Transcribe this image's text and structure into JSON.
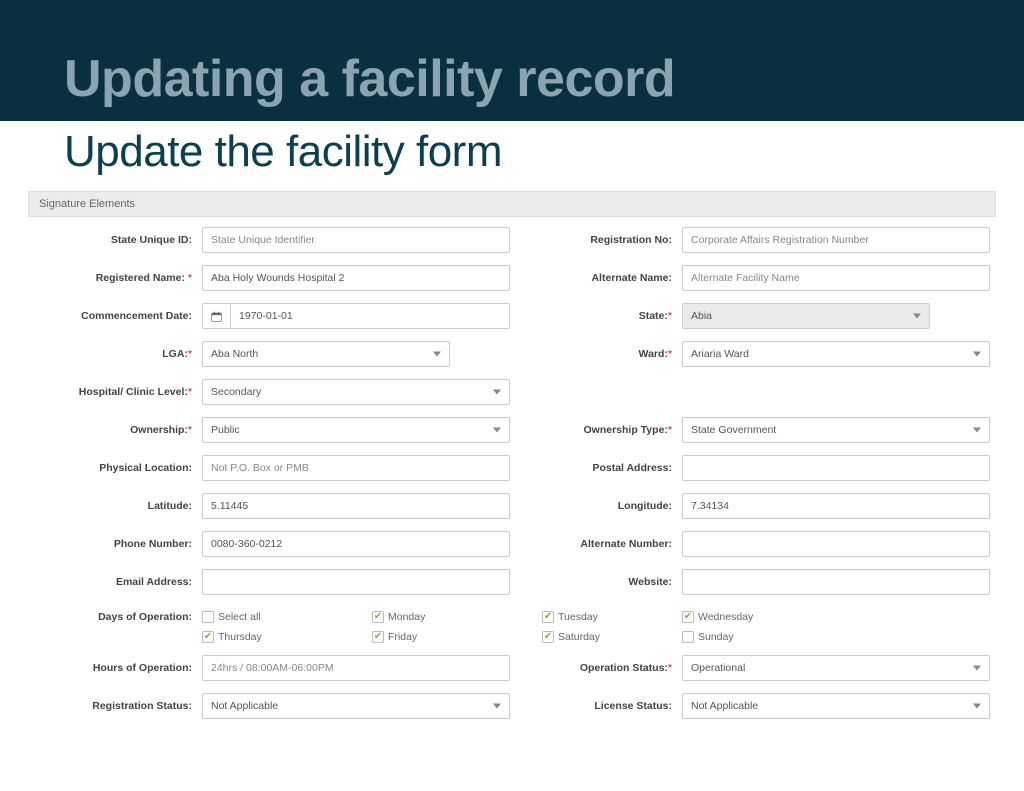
{
  "banner": {
    "title": "Updating a facility record"
  },
  "subtitle": "Update the facility form",
  "panel_heading": "Signature Elements",
  "labels": {
    "state_unique_id": "State Unique ID:",
    "registration_no": "Registration No:",
    "registered_name": "Registered Name:",
    "alternate_name": "Alternate Name:",
    "commencement_date": "Commencement Date:",
    "state": "State:",
    "lga": "LGA:",
    "ward": "Ward:",
    "hospital_level": "Hospital/ Clinic Level:",
    "ownership": "Ownership:",
    "ownership_type": "Ownership Type:",
    "physical_location": "Physical Location:",
    "postal_address": "Postal Address:",
    "latitude": "Latitude:",
    "longitude": "Longitude:",
    "phone_number": "Phone Number:",
    "alternate_number": "Alternate Number:",
    "email_address": "Email Address:",
    "website": "Website:",
    "days_of_operation": "Days of Operation:",
    "hours_of_operation": "Hours of Operation:",
    "operation_status": "Operation Status:",
    "registration_status": "Registration Status:",
    "license_status": "License Status:"
  },
  "placeholders": {
    "state_unique_id": "State Unique Identifier",
    "registration_no": "Corporate Affairs Registration Number",
    "alternate_name": "Alternate Facility Name",
    "physical_location": "Not P.O. Box or PMB",
    "hours_of_operation": "24hrs / 08:00AM-06:00PM"
  },
  "values": {
    "registered_name": "Aba Holy Wounds Hospital 2",
    "commencement_date": "1970-01-01",
    "state": "Abia",
    "lga": "Aba North",
    "ward": "Ariaria Ward",
    "hospital_level": "Secondary",
    "ownership": "Public",
    "ownership_type": "State Government",
    "latitude": "5.11445",
    "longitude": "7.34134",
    "phone_number": "0080-360-0212",
    "operation_status": "Operational",
    "registration_status": "Not Applicable",
    "license_status": "Not Applicable"
  },
  "days": {
    "select_all": {
      "label": "Select all",
      "checked": false
    },
    "monday": {
      "label": "Monday",
      "checked": true
    },
    "tuesday": {
      "label": "Tuesday",
      "checked": true
    },
    "wednesday": {
      "label": "Wednesday",
      "checked": true
    },
    "thursday": {
      "label": "Thursday",
      "checked": true
    },
    "friday": {
      "label": "Friday",
      "checked": true
    },
    "saturday": {
      "label": "Saturday",
      "checked": true
    },
    "sunday": {
      "label": "Sunday",
      "checked": false
    }
  },
  "req": "*"
}
